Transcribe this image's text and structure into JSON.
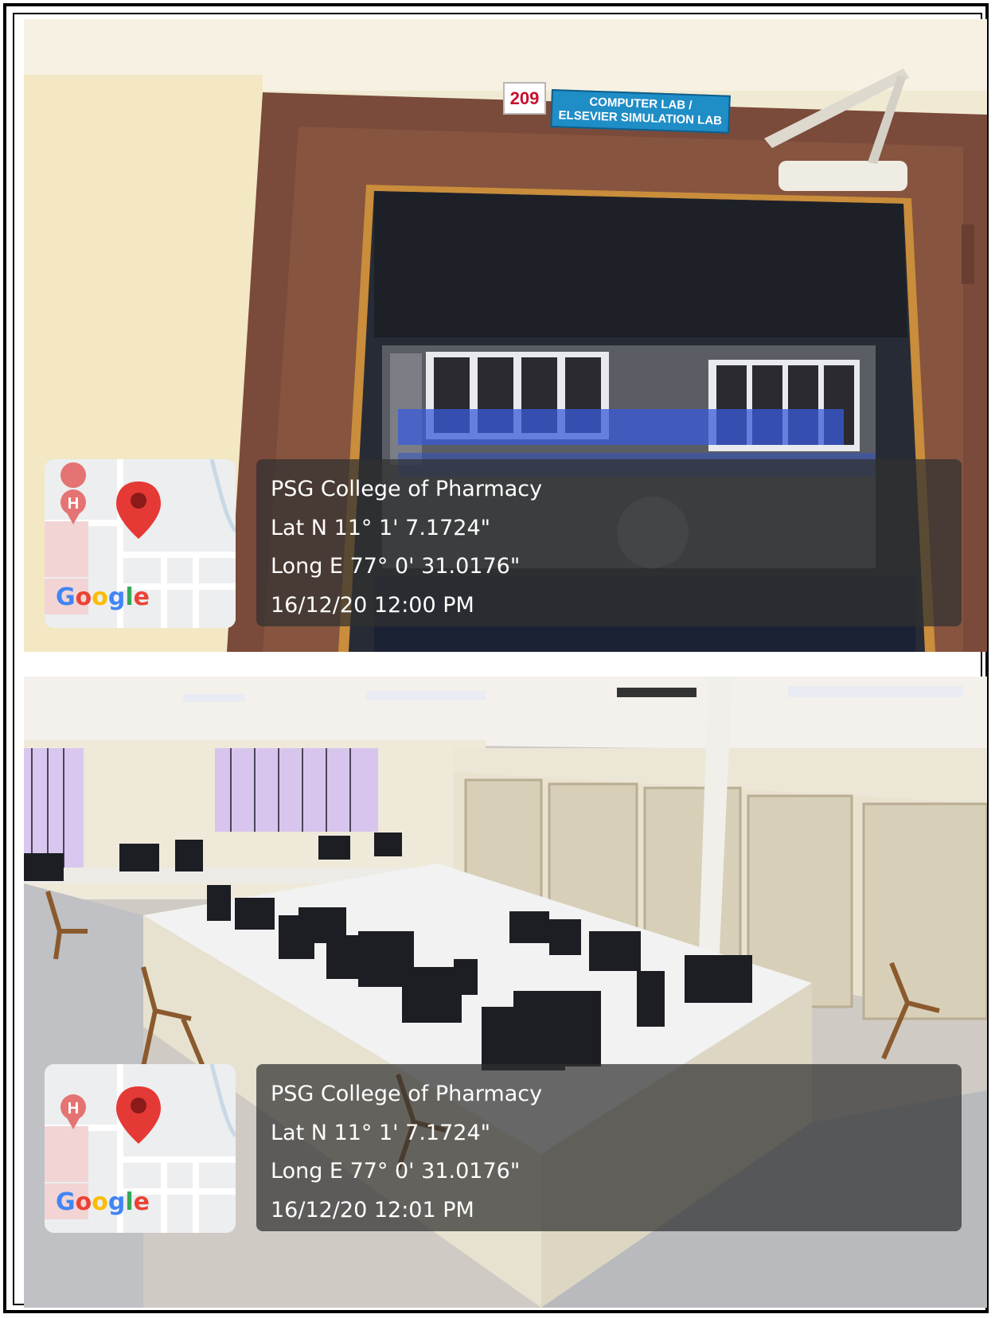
{
  "photos": [
    {
      "sign_number": "209",
      "sign_line1": "COMPUTER LAB /",
      "sign_line2": "ELSEVIER SIMULATION LAB",
      "geotag": {
        "place": "PSG College of Pharmacy",
        "lat": "Lat N 11° 1' 7.1724\"",
        "long": "Long E 77° 0' 31.0176\"",
        "datetime": "16/12/20 12:00 PM",
        "map_logo": "Google"
      }
    },
    {
      "geotag": {
        "place": "PSG College of Pharmacy",
        "lat": "Lat N 11° 1' 7.1724\"",
        "long": "Long E 77° 0' 31.0176\"",
        "datetime": "16/12/20 12:01 PM",
        "map_logo": "Google"
      }
    }
  ],
  "colors": {
    "door_frame": "#7a4a3a",
    "glass": "#2b2f3a",
    "sign_blue": "#1f8dc6",
    "pin_red": "#e53935",
    "overlay": "#303030"
  },
  "icons": [
    "map-pin-icon",
    "hospital-icon",
    "google-logo"
  ]
}
